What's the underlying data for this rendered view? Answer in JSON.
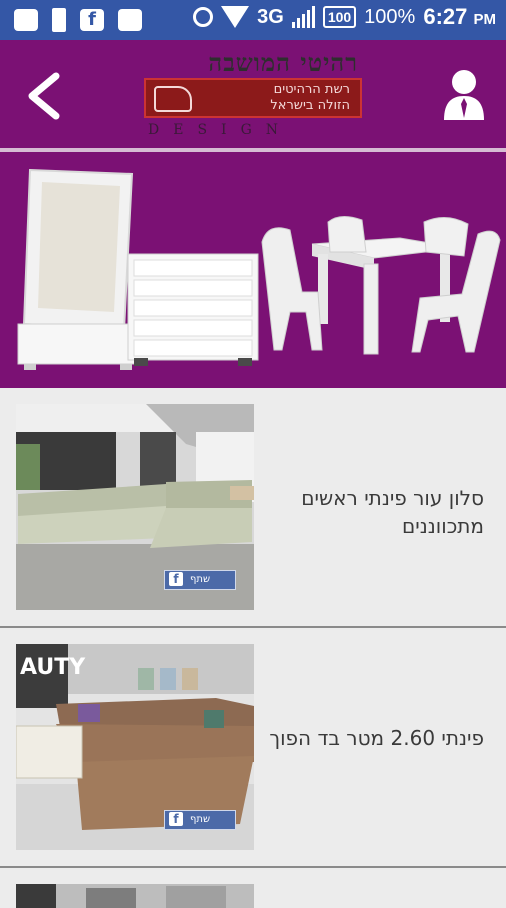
{
  "status_bar": {
    "carrier": "3G",
    "battery_badge": "100",
    "battery_percent": "100%",
    "time": "6:27",
    "ampm": "PM",
    "icons": [
      "message-icon",
      "battery-icon",
      "facebook-icon",
      "sms-icon",
      "alarm-icon",
      "wifi-icon",
      "signal-icon"
    ]
  },
  "header": {
    "logo_title": "רהיטי המושבה",
    "logo_sub_line1": "רשת הרהיטים",
    "logo_sub_line2": "הזולה בישראל",
    "logo_design": "DESIGN",
    "colors": {
      "primary": "#7b1174",
      "status": "#3457a6"
    }
  },
  "items": [
    {
      "title": "סלון עור פינתי ראשים מתכווננים",
      "fb_label": "שתף"
    },
    {
      "title": "פינתי  2.60  מטר בד הפוך",
      "fb_label": "שתף"
    }
  ]
}
